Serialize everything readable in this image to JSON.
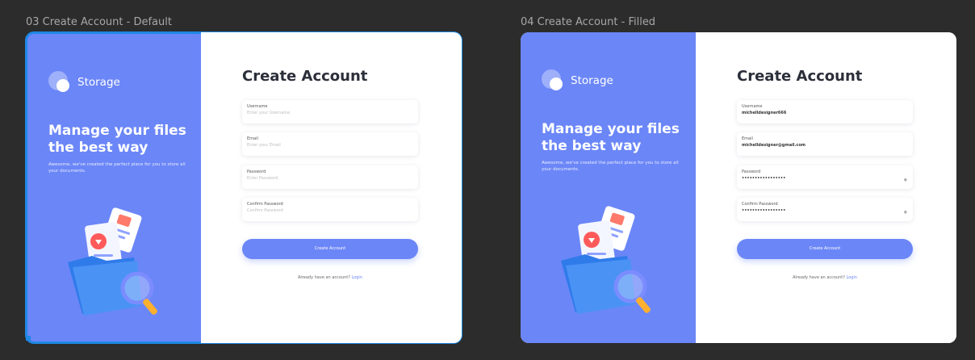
{
  "frames": [
    {
      "label": "03 Create Account - Default",
      "brand": "Storage",
      "hero_title": "Manage your files the best way",
      "hero_sub": "Awesome, we've created the perfect place for you to store all your documents.",
      "form_title": "Create Account",
      "fields": [
        {
          "label": "Username",
          "value": "Enter your Username"
        },
        {
          "label": "Email",
          "value": "Enter your Email"
        },
        {
          "label": "Password",
          "value": "Enter Password"
        },
        {
          "label": "Confirm Password",
          "value": "Confirm Password"
        }
      ],
      "cta": "Create Account",
      "signin_text": "Already have an account?",
      "signin_link": "Login"
    },
    {
      "label": "04 Create Account - Filled",
      "brand": "Storage",
      "hero_title": "Manage your files the best way",
      "hero_sub": "Awesome, we've created the perfect place for you to store all your documents.",
      "form_title": "Create Account",
      "fields": [
        {
          "label": "Username",
          "value": "michelldesigner666"
        },
        {
          "label": "Email",
          "value": "michelldesigner@gmail.com"
        },
        {
          "label": "Password",
          "value": "•••••••••••••••••"
        },
        {
          "label": "Confirm Password",
          "value": "•••••••••••••••••"
        }
      ],
      "cta": "Create Account",
      "signin_text": "Already have an account?",
      "signin_link": "Login"
    }
  ],
  "colors": {
    "brand": "#6b86f7",
    "canvas": "#2c2c2c",
    "selection": "#1e88e5"
  },
  "icons": [
    "storage-logo-icon",
    "folder-illustration-icon",
    "eye-icon"
  ]
}
